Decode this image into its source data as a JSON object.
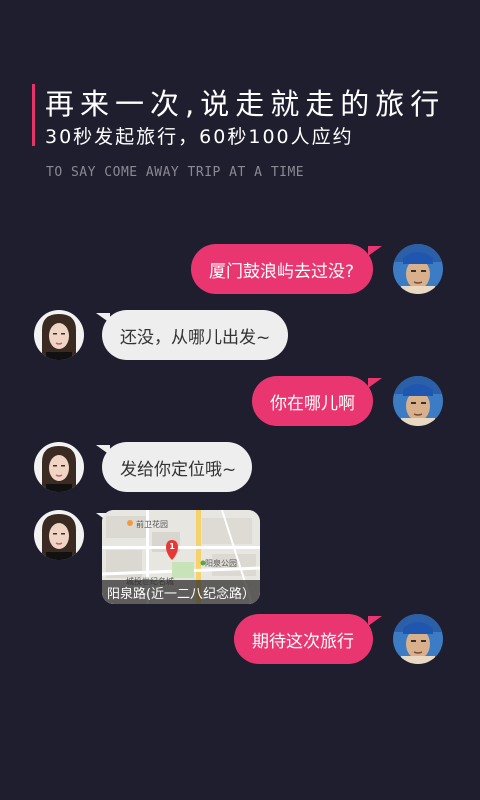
{
  "header": {
    "headline": "再来一次,说走就走的旅行",
    "subline": "30秒发起旅行，60秒100人应约",
    "tagline": "TO SAY COME AWAY TRIP AT A TIME",
    "accent_color": "#e8336a"
  },
  "colors": {
    "background": "#1f1e2e",
    "outgoing_bubble": "#ea3670",
    "incoming_bubble": "#eeeeee"
  },
  "messages": [
    {
      "from": "me",
      "text": "厦门鼓浪屿去过没?"
    },
    {
      "from": "other",
      "text": "还没，从哪儿出发~"
    },
    {
      "from": "me",
      "text": "你在哪儿啊"
    },
    {
      "from": "other",
      "text": "发给你定位哦~"
    },
    {
      "from": "other",
      "type": "location",
      "caption": "阳泉路(近一二八纪念路）",
      "map_labels": [
        "前卫花园",
        "阳泉公园",
        "城投世纪名城"
      ],
      "marker": "1"
    },
    {
      "from": "me",
      "text": "期待这次旅行"
    }
  ]
}
